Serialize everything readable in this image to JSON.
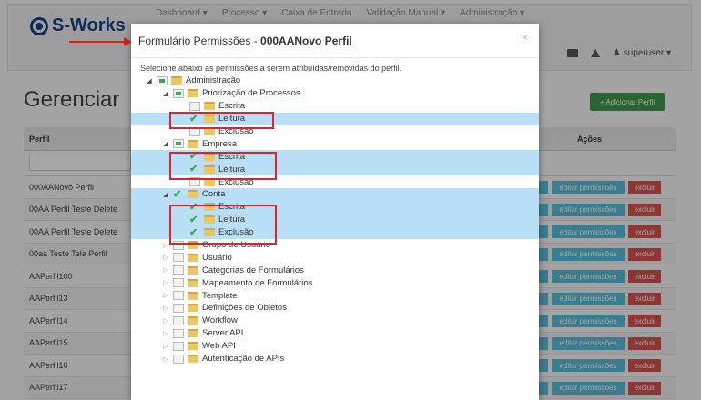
{
  "app": {
    "logo_text": "S-Works",
    "menu": [
      "Dashboard ▾",
      "Processo ▾",
      "Caixa de Entrada",
      "Validação Manual ▾",
      "Administração ▾"
    ],
    "user": "superuser ▾",
    "page_heading": "Gerenciar",
    "add_button": "+ Adicionar Perfil",
    "table_header_perfil": "Perfil",
    "table_header_acoes": "Ações",
    "rows": [
      "000AANovo Perfil",
      "00AA Perfil Teste Delete",
      "00AA Perfil Teste Delete",
      "00aa Teste Tela Perfil",
      "AAPerfil100",
      "AAPerfil13",
      "AAPerfil14",
      "AAPerfil15",
      "AAPerfil16",
      "AAPerfil17"
    ],
    "edit_label": "editar permissões",
    "delete_label": "excluir"
  },
  "modal": {
    "title_prefix": "Formulário Permissões - ",
    "title_profile": "000AANovo Perfil",
    "close": "×",
    "instruction": "Selecione abaixo as permissões a serem atribuídas/removidas do perfil."
  },
  "tree": [
    {
      "label": "Administração",
      "level": 0,
      "toggle": "open",
      "check": "partial",
      "highlight": false
    },
    {
      "label": "Priorização de Processos",
      "level": 1,
      "toggle": "open",
      "check": "partial",
      "highlight": false
    },
    {
      "label": "Escrita",
      "level": 2,
      "toggle": "none",
      "check": "unchecked",
      "highlight": false
    },
    {
      "label": "Leitura",
      "level": 2,
      "toggle": "none",
      "check": "checked",
      "highlight": true
    },
    {
      "label": "Exclusão",
      "level": 2,
      "toggle": "none",
      "check": "unchecked",
      "highlight": false
    },
    {
      "label": "Empresa",
      "level": 1,
      "toggle": "open",
      "check": "partial",
      "highlight": false
    },
    {
      "label": "Escrita",
      "level": 2,
      "toggle": "none",
      "check": "checked",
      "highlight": true
    },
    {
      "label": "Leitura",
      "level": 2,
      "toggle": "none",
      "check": "checked",
      "highlight": true
    },
    {
      "label": "Exclusão",
      "level": 2,
      "toggle": "none",
      "check": "unchecked",
      "highlight": false
    },
    {
      "label": "Conta",
      "level": 1,
      "toggle": "open",
      "check": "checked",
      "highlight": true
    },
    {
      "label": "Escrita",
      "level": 2,
      "toggle": "none",
      "check": "checked",
      "highlight": true
    },
    {
      "label": "Leitura",
      "level": 2,
      "toggle": "none",
      "check": "checked",
      "highlight": true
    },
    {
      "label": "Exclusão",
      "level": 2,
      "toggle": "none",
      "check": "checked",
      "highlight": true
    },
    {
      "label": "Grupo de Usuário",
      "level": 1,
      "toggle": "closed",
      "check": "unchecked",
      "highlight": false
    },
    {
      "label": "Usuário",
      "level": 1,
      "toggle": "closed",
      "check": "unchecked",
      "highlight": false
    },
    {
      "label": "Categorias de Formulários",
      "level": 1,
      "toggle": "closed",
      "check": "unchecked",
      "highlight": false
    },
    {
      "label": "Mapeamento de Formulários",
      "level": 1,
      "toggle": "closed",
      "check": "unchecked",
      "highlight": false
    },
    {
      "label": "Template",
      "level": 1,
      "toggle": "closed",
      "check": "unchecked",
      "highlight": false
    },
    {
      "label": "Definições de Objetos",
      "level": 1,
      "toggle": "closed",
      "check": "unchecked",
      "highlight": false
    },
    {
      "label": "Workflow",
      "level": 1,
      "toggle": "closed",
      "check": "unchecked",
      "highlight": false
    },
    {
      "label": "Server API",
      "level": 1,
      "toggle": "closed",
      "check": "unchecked",
      "highlight": false
    },
    {
      "label": "Web API",
      "level": 1,
      "toggle": "closed",
      "check": "unchecked",
      "highlight": false
    },
    {
      "label": "Autenticação de APIs",
      "level": 1,
      "toggle": "closed",
      "check": "unchecked",
      "highlight": false
    }
  ],
  "colors": {
    "highlight": "#b8dff5",
    "annotation_red": "#d9252b",
    "check_green": "#3aa84e",
    "brand_blue": "#1d3f8a"
  }
}
